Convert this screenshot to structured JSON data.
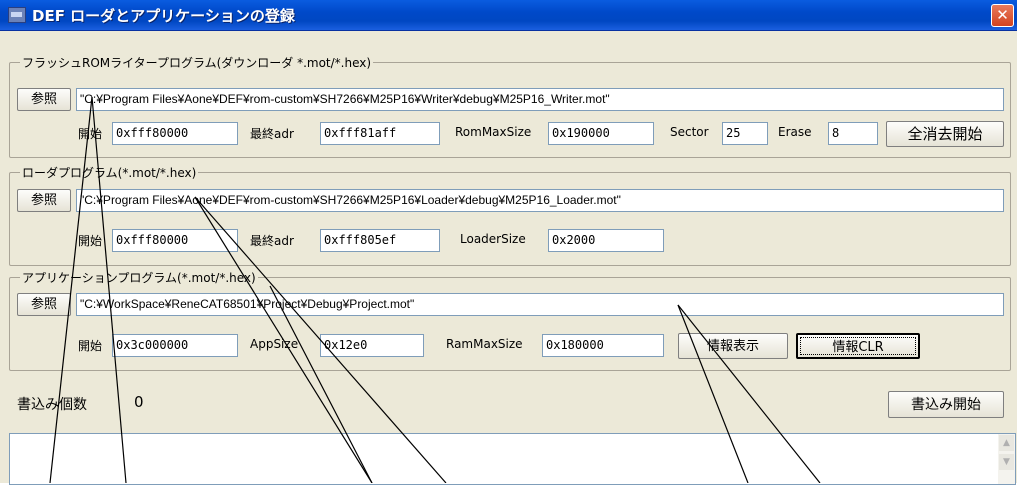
{
  "window": {
    "title": "DEF ローダとアプリケーションの登録",
    "close_glyph": "✕"
  },
  "writer": {
    "group_label": "フラッシュROMライタープログラム(ダウンローダ *.mot/*.hex)",
    "browse": "参照",
    "path": "\"C:¥Program Files¥Aone¥DEF¥rom-custom¥SH7266¥M25P16¥Writer¥debug¥M25P16_Writer.mot\"",
    "start_label": "開始",
    "start": "0xfff80000",
    "end_label": "最終adr",
    "end": "0xfff81aff",
    "rommax_label": "RomMaxSize",
    "rommax": "0x190000",
    "sector_label": "Sector",
    "sector": "25",
    "erase_label": "Erase",
    "erase": "8",
    "erase_all": "全消去開始"
  },
  "loader": {
    "group_label": "ローダプログラム(*.mot/*.hex)",
    "browse": "参照",
    "path": "\"C:¥Program Files¥Aone¥DEF¥rom-custom¥SH7266¥M25P16¥Loader¥debug¥M25P16_Loader.mot\"",
    "start_label": "開始",
    "start": "0xfff80000",
    "end_label": "最終adr",
    "end": "0xfff805ef",
    "size_label": "LoaderSize",
    "size": "0x2000"
  },
  "app": {
    "group_label": "アプリケーションプログラム(*.mot/*.hex)",
    "browse": "参照",
    "path": "\"C:¥WorkSpace¥ReneCAT68501¥Project¥Debug¥Project.mot\"",
    "start_label": "開始",
    "start": "0x3c000000",
    "size_label": "AppSize",
    "size": "0x12e0",
    "rammax_label": "RamMaxSize",
    "rammax": "0x180000",
    "info_show": "情報表示",
    "info_clr": "情報CLR"
  },
  "write": {
    "count_label": "書込み個数",
    "count": "0",
    "start_button": "書込み開始"
  },
  "log": {
    "scroll_up": "▲",
    "scroll_down": "▼"
  }
}
